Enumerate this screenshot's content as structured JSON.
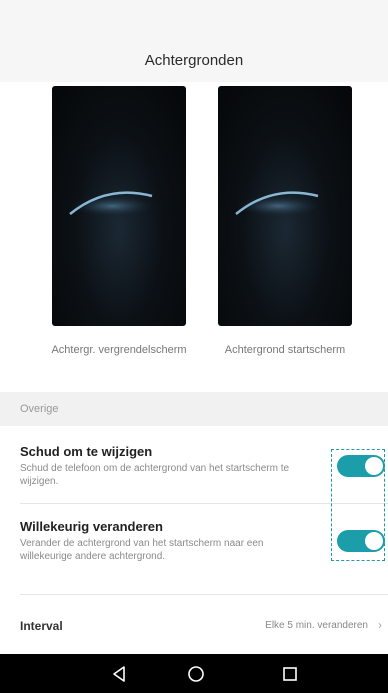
{
  "header": {
    "title": "Achtergronden"
  },
  "wallpapers": [
    {
      "label": "Achtergr. vergrendelscherm"
    },
    {
      "label": "Achtergrond startscherm"
    }
  ],
  "section": {
    "title": "Overige"
  },
  "settings": [
    {
      "title": "Schud om te wijzigen",
      "description": "Schud de telefoon om de achtergrond van het startscherm te wijzigen.",
      "enabled": true
    },
    {
      "title": "Willekeurig veranderen",
      "description": "Verander de achtergrond van het startscherm naar een willekeurige andere achtergrond.",
      "enabled": true
    }
  ],
  "interval": {
    "label": "Interval",
    "value": "Elke 5 min. veranderen"
  },
  "colors": {
    "accent": "#1b9eaa",
    "highlight": "#1d9aa5"
  },
  "navbar": {
    "icons": [
      "back-icon",
      "home-icon",
      "recents-icon"
    ]
  }
}
